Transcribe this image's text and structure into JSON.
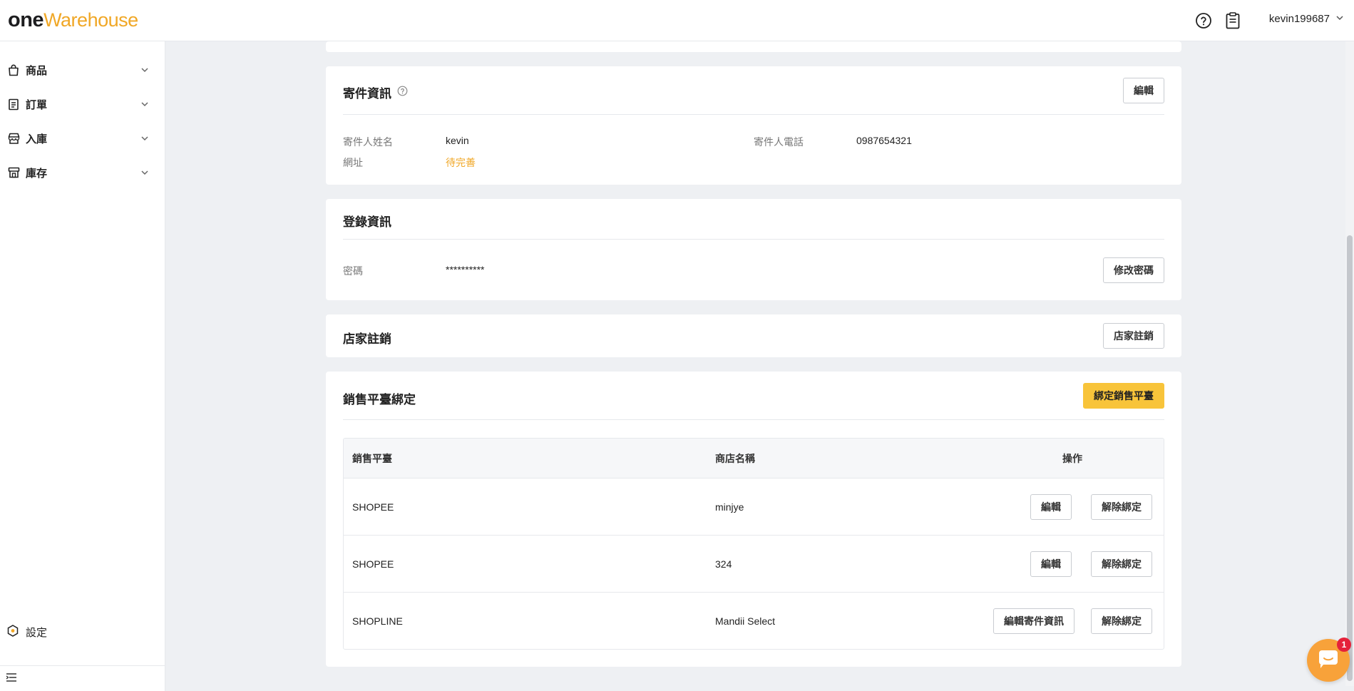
{
  "logo": {
    "part1": "one",
    "part2": "Warehouse"
  },
  "header": {
    "username": "kevin199687"
  },
  "sidebar": {
    "items": [
      {
        "label": "商品",
        "icon": "shopping-bag-icon"
      },
      {
        "label": "訂單",
        "icon": "order-list-icon"
      },
      {
        "label": "入庫",
        "icon": "inbound-store-icon"
      },
      {
        "label": "庫存",
        "icon": "warehouse-store-icon"
      }
    ],
    "settings_label": "設定"
  },
  "sender_info": {
    "title": "寄件資訊",
    "edit_label": "編輯",
    "name_label": "寄件人姓名",
    "name_value": "kevin",
    "phone_label": "寄件人電話",
    "phone_value": "0987654321",
    "address_label": "網址",
    "address_value": "待完善"
  },
  "login_info": {
    "title": "登錄資訊",
    "password_label": "密碼",
    "password_value": "**********",
    "change_password_label": "修改密碼"
  },
  "deregister": {
    "title": "店家註銷",
    "button_label": "店家註銷"
  },
  "platform_binding": {
    "title": "銷售平臺綁定",
    "bind_button_label": "綁定銷售平臺",
    "columns": {
      "platform": "銷售平臺",
      "store": "商店名稱",
      "actions": "操作"
    },
    "rows": [
      {
        "platform": "SHOPEE",
        "store": "minjye",
        "edit_label": "編輯",
        "unbind_label": "解除綁定"
      },
      {
        "platform": "SHOPEE",
        "store": "324",
        "edit_label": "編輯",
        "unbind_label": "解除綁定"
      },
      {
        "platform": "SHOPLINE",
        "store": "Mandii Select",
        "edit_label": "編輯寄件資訊",
        "unbind_label": "解除綁定"
      }
    ]
  },
  "chat": {
    "badge_count": "1"
  },
  "colors": {
    "accent": "#f8c43a",
    "brand_orange": "#f0a726",
    "warn": "#f0a726"
  }
}
